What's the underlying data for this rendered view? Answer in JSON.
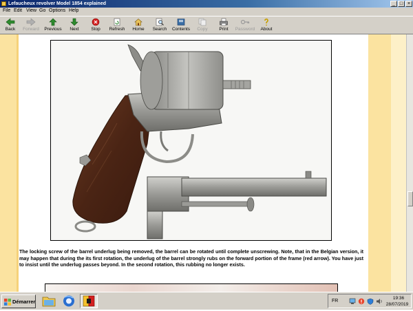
{
  "window": {
    "title": "Lefaucheux revolver Model 1854 explained"
  },
  "menu": [
    "File",
    "Edit",
    "View",
    "Go",
    "Options",
    "Help"
  ],
  "toolbar": [
    {
      "label": "Back",
      "icon": "back-arrow-icon",
      "enabled": true
    },
    {
      "label": "Forward",
      "icon": "forward-arrow-icon",
      "enabled": false
    },
    {
      "label": "Previous",
      "icon": "previous-up-arrow-icon",
      "enabled": true
    },
    {
      "label": "Next",
      "icon": "next-down-arrow-icon",
      "enabled": true
    },
    {
      "label": "Stop",
      "icon": "stop-icon",
      "enabled": true
    },
    {
      "label": "Refresh",
      "icon": "refresh-icon",
      "enabled": true
    },
    {
      "label": "Home",
      "icon": "home-icon",
      "enabled": true
    },
    {
      "label": "Search",
      "icon": "search-icon",
      "enabled": true
    },
    {
      "label": "Contents",
      "icon": "contents-book-icon",
      "enabled": true
    },
    {
      "label": "Copy",
      "icon": "copy-icon",
      "enabled": false
    },
    {
      "label": "Print",
      "icon": "printer-icon",
      "enabled": true
    },
    {
      "label": "Password",
      "icon": "key-icon",
      "enabled": false
    },
    {
      "label": "About",
      "icon": "about-icon",
      "enabled": true
    }
  ],
  "content": {
    "caption": "The locking screw of the barrel underlug being removed, the barrel can be rotated until complete unscrewing. Note, that in the Belgian version, it may happen that during the its first rotation, the underlug of the barrel strongly rubs on the forward portion of the frame (red arrow). You have just to insist until the underlug passes beyond. In the second rotation, this rubbing no longer exists."
  },
  "taskbar": {
    "start_label": "Démarrer",
    "lang": "FR",
    "time": "19:36",
    "date": "28/07/2019"
  },
  "colors": {
    "page_band": "#fbe3a0",
    "titlebar": "#0a246a"
  }
}
